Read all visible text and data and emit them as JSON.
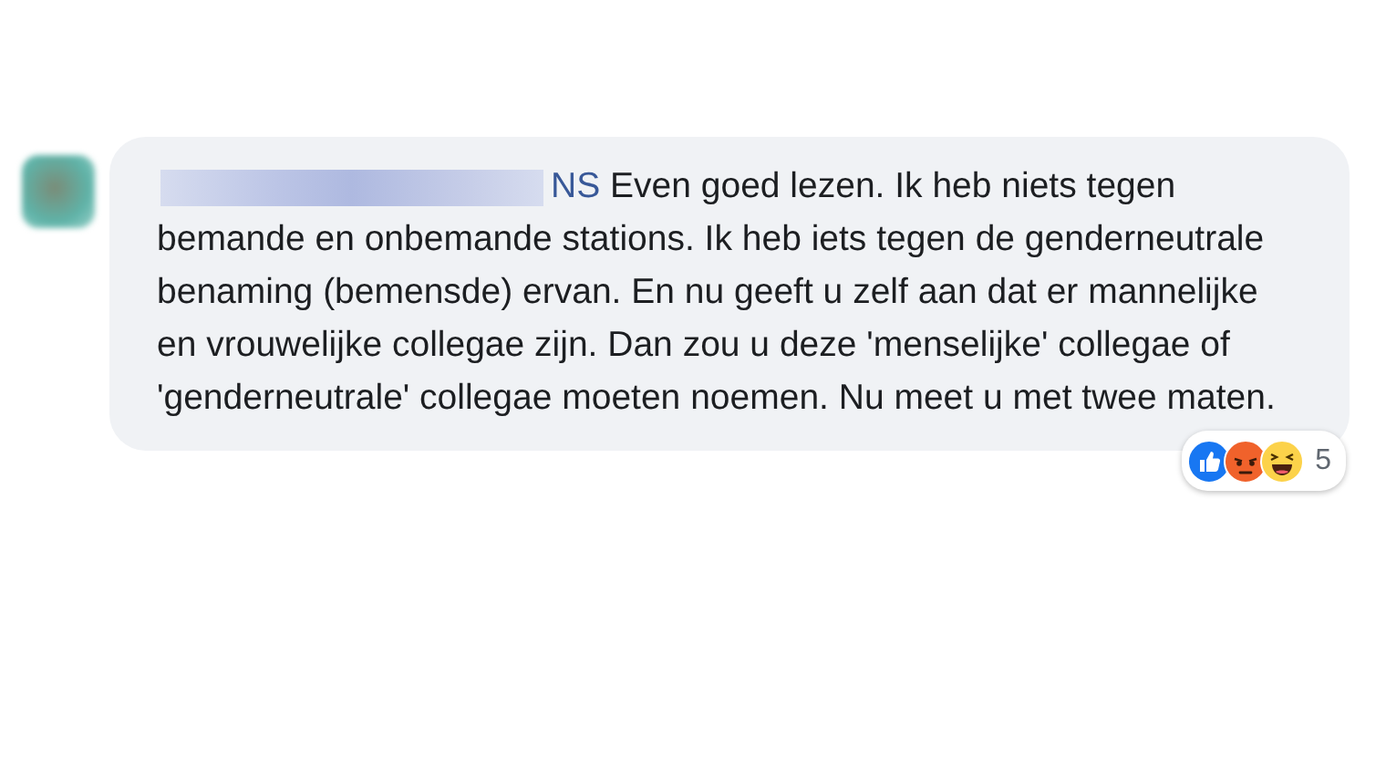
{
  "comment": {
    "mention": "NS",
    "text": " Even goed lezen. Ik heb niets tegen bemande en onbemande stations. Ik heb iets tegen de genderneutrale benaming (bemensde) ervan. En nu geeft u zelf aan dat er mannelijke en vrouwelijke collegae zijn. Dan zou u deze 'menselijke' collegae of 'genderneutrale' collegae moeten noemen. Nu meet u met twee maten.",
    "reactions": {
      "types": [
        {
          "kind": "like"
        },
        {
          "kind": "angry"
        },
        {
          "kind": "haha"
        }
      ],
      "count": "5"
    }
  }
}
